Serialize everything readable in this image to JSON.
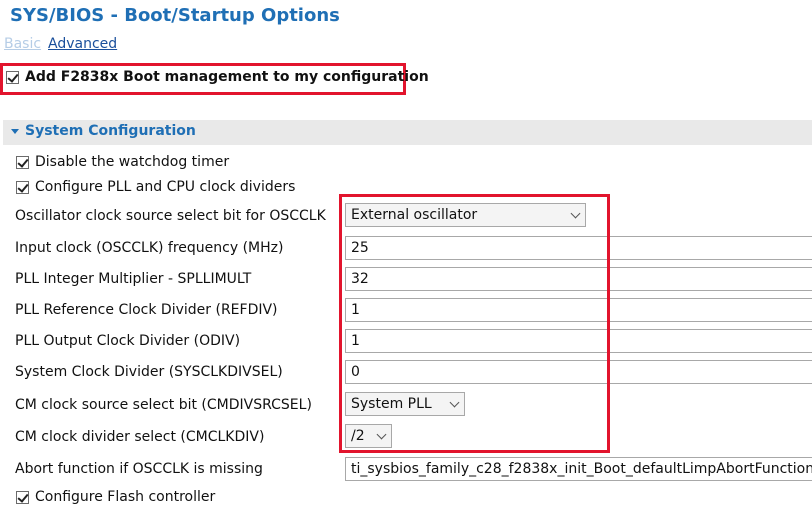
{
  "header": {
    "title": "SYS/BIOS - Boot/Startup Options",
    "mode_basic": "Basic",
    "mode_advanced": "Advanced"
  },
  "boot_management": {
    "label": "Add F2838x Boot management to my configuration",
    "checked": true
  },
  "section": {
    "title": "System Configuration",
    "items": {
      "disable_watchdog": {
        "label": "Disable the watchdog timer",
        "checked": true
      },
      "configure_pll": {
        "label": "Configure PLL and CPU clock dividers",
        "checked": true
      },
      "osc_source": {
        "label": "Oscillator clock source select bit for OSCCLK",
        "value": "External oscillator"
      },
      "input_clock": {
        "label": "Input clock (OSCCLK) frequency (MHz)",
        "value": "25"
      },
      "pll_mult": {
        "label": "PLL Integer Multiplier - SPLLIMULT",
        "value": "32"
      },
      "pll_refdiv": {
        "label": "PLL Reference Clock Divider (REFDIV)",
        "value": "1"
      },
      "pll_odiv": {
        "label": "PLL Output Clock Divider (ODIV)",
        "value": "1"
      },
      "sysclkdivsel": {
        "label": "System Clock Divider (SYSCLKDIVSEL)",
        "value": "0"
      },
      "cm_source": {
        "label": "CM clock source select bit (CMDIVSRCSEL)",
        "value": "System PLL"
      },
      "cm_div": {
        "label": "CM clock divider select (CMCLKDIV)",
        "value": "/2"
      },
      "abort_fn": {
        "label": "Abort function if OSCCLK is missing",
        "value": "ti_sysbios_family_c28_f2838x_init_Boot_defaultLimpAbortFunction"
      },
      "configure_flash": {
        "label": "Configure Flash controller",
        "checked": true
      }
    }
  },
  "colors": {
    "accent": "#1f6fb5",
    "highlight_border": "#e2142d",
    "section_background": "#e9e9e9"
  }
}
